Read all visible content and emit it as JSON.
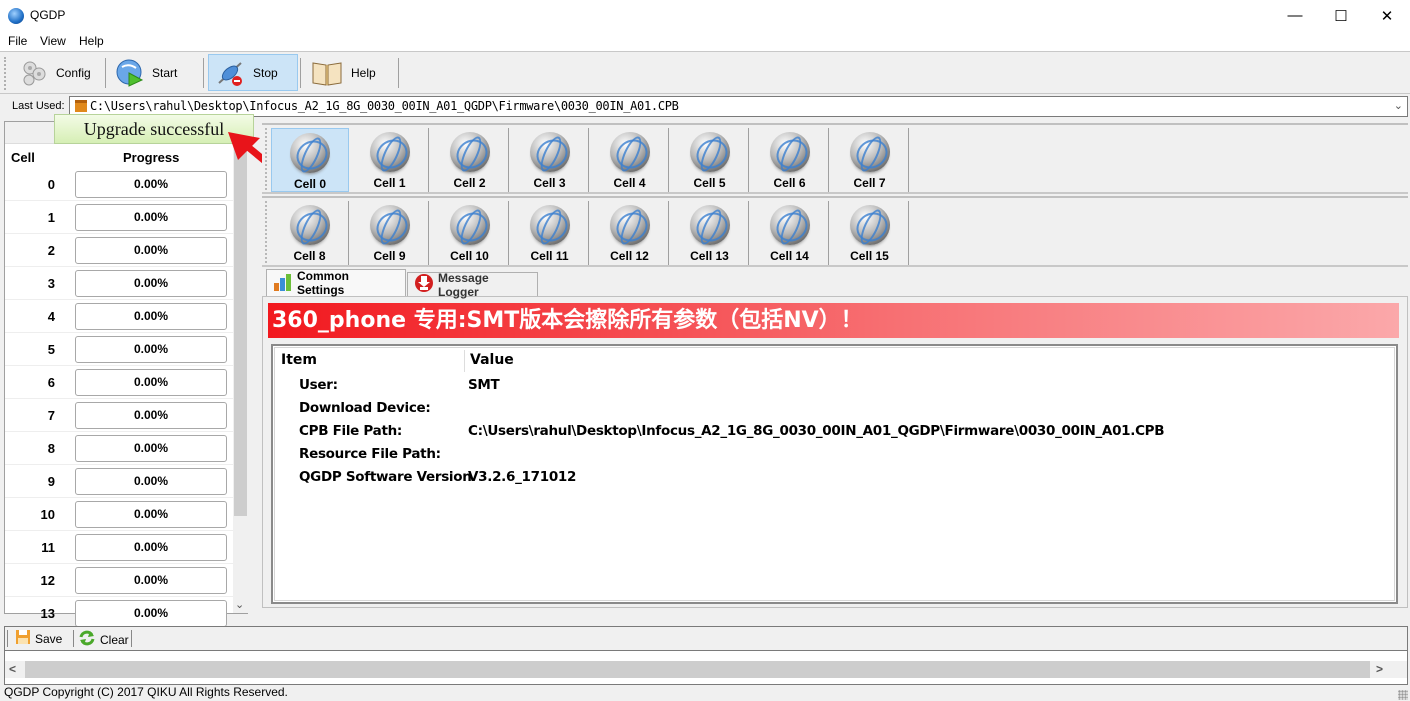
{
  "window": {
    "title": "QGDP",
    "icon": "globe-app-icon",
    "controls": {
      "minimize": "—",
      "maximize": "☐",
      "close": "✕"
    }
  },
  "menu": [
    "File",
    "View",
    "Help"
  ],
  "toolbar": {
    "buttons": [
      {
        "label": "Config",
        "icon": "gears-icon",
        "active": false
      },
      {
        "label": "Start",
        "icon": "play-globe-icon",
        "active": false
      },
      {
        "label": "Stop",
        "icon": "disconnect-icon",
        "active": true
      },
      {
        "label": "Help",
        "icon": "book-icon",
        "active": false
      }
    ]
  },
  "last_used": {
    "label": "Last Used:",
    "value": "C:\\Users\\rahul\\Desktop\\Infocus_A2_1G_8G_0030_00IN_A01_QGDP\\Firmware\\0030_00IN_A01.CPB"
  },
  "tooltip": {
    "text": "Upgrade successful"
  },
  "progress_table": {
    "columns": [
      "Cell",
      "Progress"
    ],
    "rows": [
      {
        "cell": "0",
        "progress": "0.00%"
      },
      {
        "cell": "1",
        "progress": "0.00%"
      },
      {
        "cell": "2",
        "progress": "0.00%"
      },
      {
        "cell": "3",
        "progress": "0.00%"
      },
      {
        "cell": "4",
        "progress": "0.00%"
      },
      {
        "cell": "5",
        "progress": "0.00%"
      },
      {
        "cell": "6",
        "progress": "0.00%"
      },
      {
        "cell": "7",
        "progress": "0.00%"
      },
      {
        "cell": "8",
        "progress": "0.00%"
      },
      {
        "cell": "9",
        "progress": "0.00%"
      },
      {
        "cell": "10",
        "progress": "0.00%"
      },
      {
        "cell": "11",
        "progress": "0.00%"
      },
      {
        "cell": "12",
        "progress": "0.00%"
      },
      {
        "cell": "13",
        "progress": "0.00%"
      }
    ]
  },
  "cells_row1": [
    "Cell 0",
    "Cell 1",
    "Cell 2",
    "Cell 3",
    "Cell 4",
    "Cell 5",
    "Cell 6",
    "Cell 7"
  ],
  "cells_row2": [
    "Cell 8",
    "Cell 9",
    "Cell 10",
    "Cell 11",
    "Cell 12",
    "Cell 13",
    "Cell 14",
    "Cell 15"
  ],
  "selected_cell": "Cell 0",
  "tabs": [
    {
      "label": "Common Settings",
      "icon": "bar-chart-icon",
      "active": true
    },
    {
      "label": "Message Logger",
      "icon": "download-icon",
      "active": false
    }
  ],
  "banner": {
    "text": "360_phone 专用:SMT版本会擦除所有参数（包括NV）！",
    "color_start": "#f2181e",
    "color_end": "#fba8aa"
  },
  "settings_table": {
    "columns": [
      "Item",
      "Value"
    ],
    "rows": [
      {
        "item": "User:",
        "value": "SMT"
      },
      {
        "item": "Download Device:",
        "value": ""
      },
      {
        "item": "CPB File Path:",
        "value": "C:\\Users\\rahul\\Desktop\\Infocus_A2_1G_8G_0030_00IN_A01_QGDP\\Firmware\\0030_00IN_A01.CPB"
      },
      {
        "item": "Resource File Path:",
        "value": ""
      },
      {
        "item": "QGDP Software Version",
        "value": "V3.2.6_171012"
      }
    ]
  },
  "logger_toolbar": {
    "save": "Save",
    "clear": "Clear"
  },
  "status": {
    "text": "QGDP Copyright (C) 2017 QIKU All Rights Reserved."
  }
}
